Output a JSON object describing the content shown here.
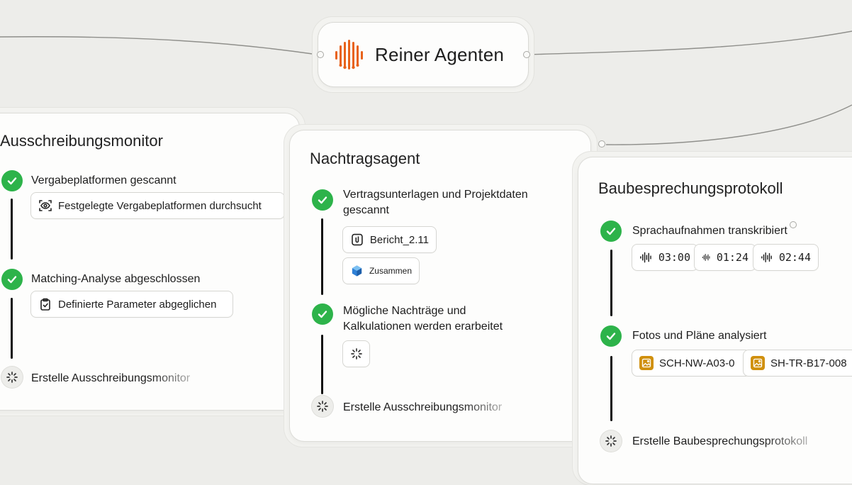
{
  "hub": {
    "title": "Reiner Agenten",
    "logo_color": "#e8621a"
  },
  "accent": {
    "check": "#2db34a",
    "badge": "#d0900e"
  },
  "cards": {
    "ausschreibung": {
      "title": "Ausschreibungsmonitor",
      "steps": [
        {
          "label": "Vergabeplatformen gescannt",
          "status": "done"
        },
        {
          "label": "Matching-Analyse abgeschlossen",
          "status": "done"
        },
        {
          "label": "Erstelle Ausschreibungsmonitor",
          "status": "loading"
        }
      ],
      "chips": [
        {
          "label": "Festgelegte Vergabeplatformen durchsucht",
          "icon": "eye-scan-icon"
        },
        {
          "label": "Definierte Parameter abgeglichen",
          "icon": "clipboard-check-icon"
        }
      ]
    },
    "nachtrag": {
      "title": "Nachtragsagent",
      "steps": [
        {
          "label_line1": "Vertragsunterlagen und Projektdaten",
          "label_line2": "gescannt",
          "status": "done"
        },
        {
          "label_line1": "Mögliche Nachträge und",
          "label_line2": "Kalkulationen werden erarbeitet",
          "status": "done"
        },
        {
          "label": "Erstelle Ausschreibungsmonitor",
          "status": "loading"
        }
      ],
      "chips": [
        {
          "label": "Bericht_2.11",
          "icon": "paperclip-icon"
        },
        {
          "label": "Zusammen",
          "icon": "app-cube-icon"
        }
      ]
    },
    "baubesprechung": {
      "title": "Baubesprechungsprotokoll",
      "steps": [
        {
          "label": "Sprachaufnahmen transkribiert",
          "status": "done"
        },
        {
          "label": "Fotos und Pläne analysiert",
          "status": "done"
        },
        {
          "label": "Erstelle Baubesprechungsprotokoll",
          "status": "loading"
        }
      ],
      "audio": [
        "03:00",
        "01:24",
        "02:44"
      ],
      "images": [
        "SCH-NW-A03-0",
        "SH-TR-B17-008"
      ]
    }
  }
}
